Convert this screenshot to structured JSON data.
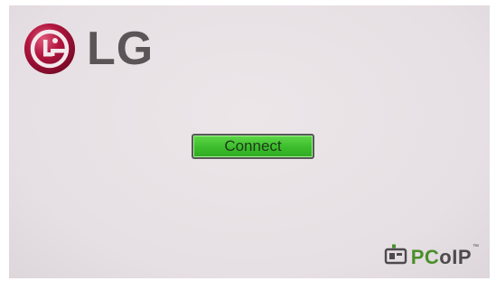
{
  "brand": {
    "wordmark": "LG",
    "logo_color": "#a50034",
    "wordmark_color": "#5b5557"
  },
  "connect": {
    "label": "Connect",
    "color": "#3cbd2c"
  },
  "footer": {
    "pcoip_pc": "PC",
    "pcoip_rest": "oIP",
    "trademark": "™",
    "pc_color": "#4a8f2a"
  },
  "icons": {
    "lg_logo": "lg-face-emblem",
    "pcoip": "pcoip-monitor-icon"
  }
}
